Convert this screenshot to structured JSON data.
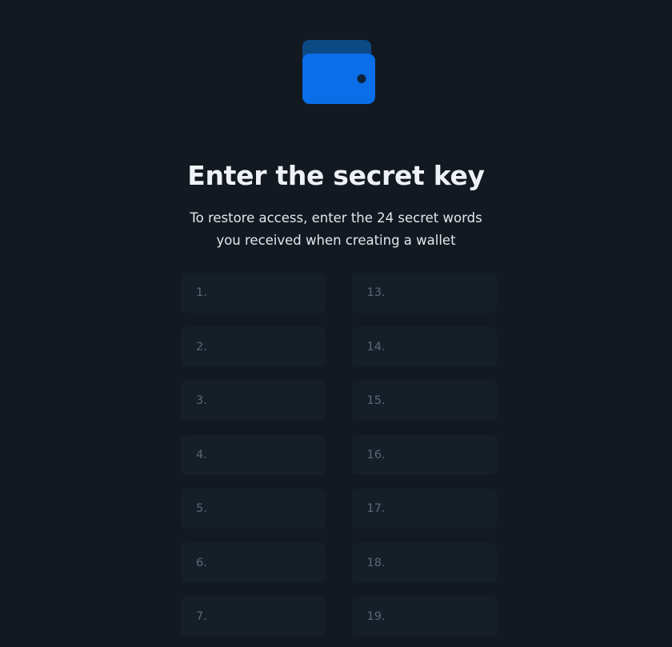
{
  "header": {
    "icon": "wallet-icon",
    "title": "Enter the secret key",
    "subtitle_line1": "To restore access, enter the 24 secret words",
    "subtitle_line2": "you received when creating a wallet"
  },
  "word_inputs": {
    "left": [
      {
        "placeholder": "1.",
        "value": ""
      },
      {
        "placeholder": "2.",
        "value": ""
      },
      {
        "placeholder": "3.",
        "value": ""
      },
      {
        "placeholder": "4.",
        "value": ""
      },
      {
        "placeholder": "5.",
        "value": ""
      },
      {
        "placeholder": "6.",
        "value": ""
      },
      {
        "placeholder": "7.",
        "value": ""
      }
    ],
    "right": [
      {
        "placeholder": "13.",
        "value": ""
      },
      {
        "placeholder": "14.",
        "value": ""
      },
      {
        "placeholder": "15.",
        "value": ""
      },
      {
        "placeholder": "16.",
        "value": ""
      },
      {
        "placeholder": "17.",
        "value": ""
      },
      {
        "placeholder": "18.",
        "value": ""
      },
      {
        "placeholder": "19.",
        "value": ""
      }
    ]
  },
  "colors": {
    "background": "#131921",
    "accent": "#0a6ee8",
    "accent_dark": "#0c4a86",
    "input_background": "#161e28",
    "placeholder": "#5b6877"
  }
}
